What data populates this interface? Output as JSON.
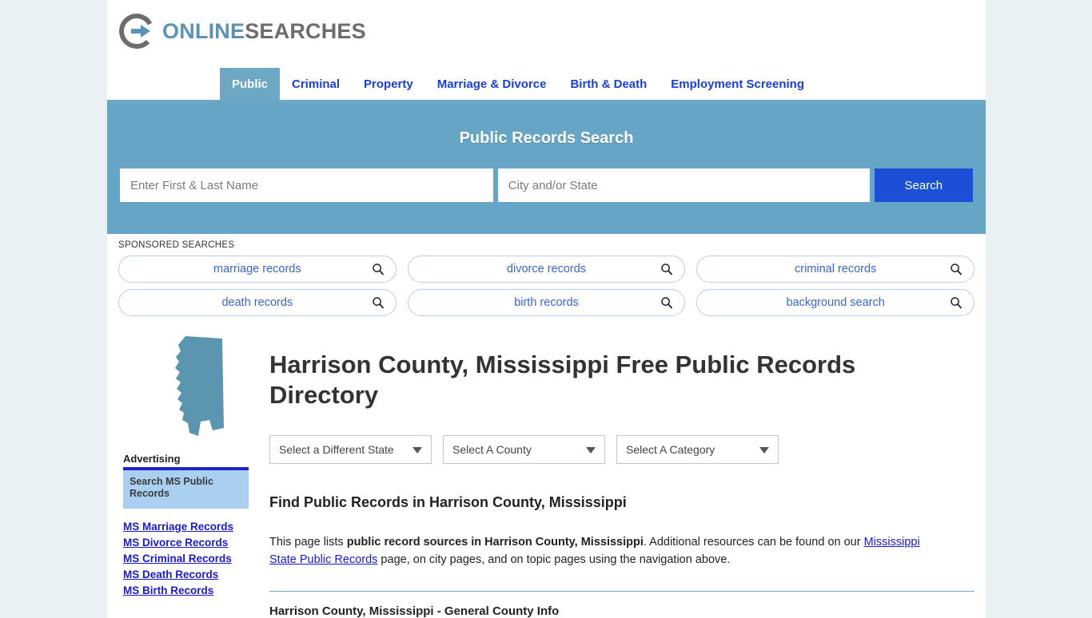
{
  "brand": {
    "logo_icon": "circle-arrow-logo-icon",
    "name_part1": "ONLINE",
    "name_part2": "SEARCHES",
    "accent_blue": "#5b93b5",
    "accent_gray": "#6d6d6d"
  },
  "nav": {
    "tabs": [
      {
        "label": "Public",
        "active": true
      },
      {
        "label": "Criminal",
        "active": false
      },
      {
        "label": "Property",
        "active": false
      },
      {
        "label": "Marriage & Divorce",
        "active": false
      },
      {
        "label": "Birth & Death",
        "active": false
      },
      {
        "label": "Employment Screening",
        "active": false
      }
    ]
  },
  "banner": {
    "title": "Public Records Search",
    "background": "#66a5c5",
    "name_value": "",
    "name_placeholder": "Enter First & Last Name",
    "city_value": "",
    "city_placeholder": "City and/or State",
    "search_button": "Search",
    "search_button_color": "#1a4fd6"
  },
  "sponsored": {
    "label": "SPONSORED SEARCHES",
    "pills": [
      {
        "label": "marriage records",
        "icon": "search-icon"
      },
      {
        "label": "divorce records",
        "icon": "search-icon"
      },
      {
        "label": "criminal records",
        "icon": "search-icon"
      },
      {
        "label": "death records",
        "icon": "search-icon"
      },
      {
        "label": "birth records",
        "icon": "search-icon"
      },
      {
        "label": "background search",
        "icon": "search-icon"
      }
    ]
  },
  "sidebar": {
    "map_icon": "mississippi-state-map-icon",
    "map_color": "#5b95b0",
    "advertising_label": "Advertising",
    "ad_box_text": "Search MS Public Records",
    "links": [
      {
        "label": "MS Marriage Records"
      },
      {
        "label": "MS Divorce Records"
      },
      {
        "label": "MS Criminal Records"
      },
      {
        "label": "MS Death Records"
      },
      {
        "label": "MS Birth Records"
      }
    ]
  },
  "main": {
    "page_title": "Harrison County, Mississippi Free Public Records Directory",
    "selects": [
      {
        "value": "Select a Different State",
        "icon": "chevron-down-icon"
      },
      {
        "value": "Select A County",
        "icon": "chevron-down-icon"
      },
      {
        "value": "Select A Category",
        "icon": "chevron-down-icon"
      }
    ],
    "section_title": "Find Public Records in Harrison County, Mississippi",
    "intro": {
      "part1": "This page lists ",
      "bold1": "public record sources in Harrison County, Mississippi",
      "part2": ". Additional resources can be found on our ",
      "link": "Mississippi State Public Records",
      "part3": " page, on city pages, and on topic pages using the navigation above."
    },
    "subhead": "Harrison County, Mississippi - General County Info"
  }
}
